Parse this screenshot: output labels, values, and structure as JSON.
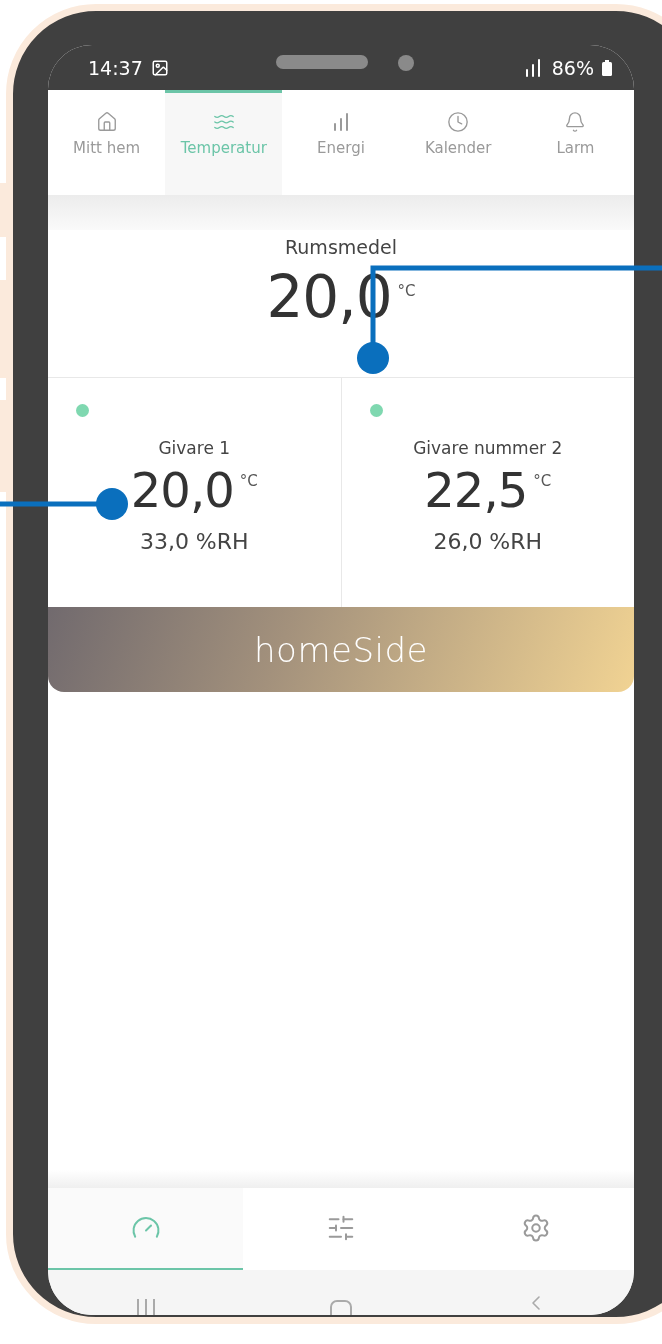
{
  "status_bar": {
    "time": "14:37",
    "battery": "86%"
  },
  "tabs": [
    {
      "kind": "home",
      "label": "Mitt hem",
      "selected": false
    },
    {
      "kind": "waves",
      "label": "Temperatur",
      "selected": true
    },
    {
      "kind": "bars",
      "label": "Energi",
      "selected": false
    },
    {
      "kind": "clock",
      "label": "Kalender",
      "selected": false
    },
    {
      "kind": "bell",
      "label": "Larm",
      "selected": false
    }
  ],
  "average": {
    "label": "Rumsmedel",
    "value": "20,0",
    "unit": "°C"
  },
  "sensors": [
    {
      "name": "Givare 1",
      "value": "20,0",
      "unit": "°C",
      "humidity": "33,0 %RH",
      "color": "#7fd8b0"
    },
    {
      "name": "Givare nummer 2",
      "value": "22,5",
      "unit": "°C",
      "humidity": "26,0 %RH",
      "color": "#7fd8b0"
    }
  ],
  "brand": "homeSide",
  "bottom_nav": [
    {
      "kind": "gauge",
      "selected": true
    },
    {
      "kind": "sliders",
      "selected": false
    },
    {
      "kind": "settings",
      "selected": false
    }
  ]
}
